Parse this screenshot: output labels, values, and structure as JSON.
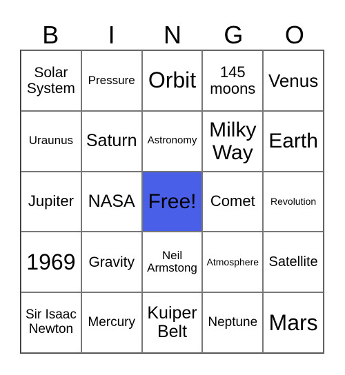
{
  "header": {
    "letters": [
      "B",
      "I",
      "N",
      "G",
      "O"
    ]
  },
  "free_color": "#4a5fe8",
  "cells": [
    [
      "Solar System",
      "Pressure",
      "Orbit",
      "145 moons",
      "Venus"
    ],
    [
      "Uraunus",
      "Saturn",
      "Astronomy",
      "Milky Way",
      "Earth"
    ],
    [
      "Jupiter",
      "NASA",
      "Free!",
      "Comet",
      "Revolution"
    ],
    [
      "1969",
      "Gravity",
      "Neil Armstong",
      "Atmosphere",
      "Satellite"
    ],
    [
      "Sir Isaac Newton",
      "Mercury",
      "Kuiper Belt",
      "Neptune",
      "Mars"
    ]
  ]
}
